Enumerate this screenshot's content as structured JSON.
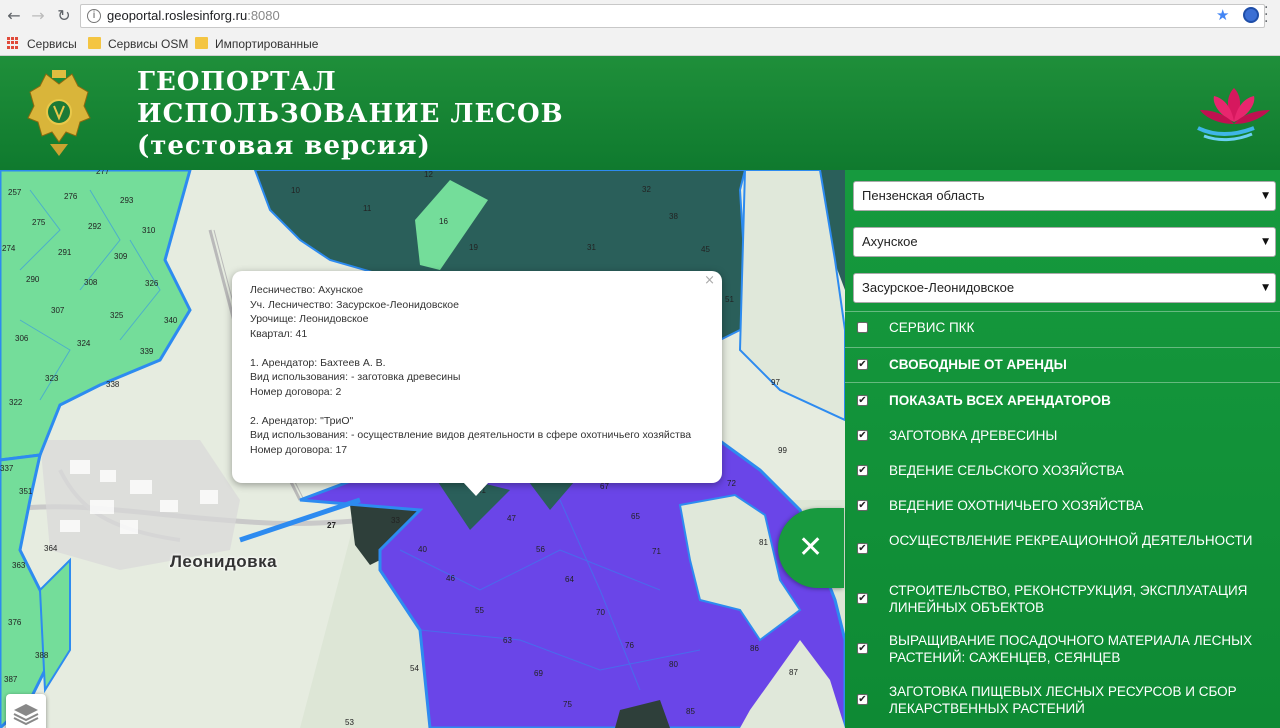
{
  "browser": {
    "url_host": "geoportal.roslesinforg.ru",
    "url_port": ":8080",
    "back_icon": "←",
    "forward_icon": "→",
    "reload_icon": "↻",
    "bookmarks": [
      "Сервисы",
      "Сервисы OSM",
      "Импортированные"
    ]
  },
  "header": {
    "title_line1": "ГЕОПОРТАЛ",
    "title_line2": "ИСПОЛЬЗОВАНИЕ ЛЕСОВ",
    "title_line3": "(тестовая версия)"
  },
  "map": {
    "town_label": "Леонидовка",
    "colors": {
      "tenant": "#6a45e8",
      "free": "#2a5f5a",
      "other": "#74dd9a",
      "boundary": "#2d8bf0"
    },
    "quarter_labels": [
      "257",
      "276",
      "277",
      "293",
      "275",
      "292",
      "310",
      "274",
      "291",
      "309",
      "290",
      "308",
      "326",
      "307",
      "325",
      "340",
      "306",
      "324",
      "339",
      "323",
      "338",
      "322",
      "337",
      "351",
      "364",
      "363",
      "376",
      "388",
      "387",
      "10",
      "11",
      "12",
      "16",
      "19",
      "31",
      "32",
      "38",
      "45",
      "51",
      "97",
      "99",
      "72",
      "81",
      "86",
      "87",
      "67",
      "65",
      "71",
      "47",
      "56",
      "64",
      "70",
      "76",
      "80",
      "85",
      "75",
      "69",
      "63",
      "55",
      "46",
      "40",
      "33",
      "41",
      "27",
      "54",
      "53"
    ]
  },
  "popup": {
    "close_icon": "×",
    "lines": [
      "Лесничество: Ахунское",
      "Уч. Лесничество: Засурское-Леонидовское",
      "Урочище: Леонидовское",
      "Квартал: 41",
      "",
      "1. Арендатор: Бахтеев А. В.",
      "Вид использования: - заготовка древесины",
      "Номер договора: 2",
      "",
      "2. Арендатор: \"ТриО\"",
      "Вид использования: - осуществление видов деятельности в сфере охотничьего хозяйства",
      "Номер договора: 17"
    ]
  },
  "panel": {
    "selects": [
      "Пензенская область",
      "Ахунское",
      "Засурское-Леонидовское"
    ],
    "select_arrow": "▼",
    "items": [
      {
        "label": "СЕРВИС ПКК",
        "checked": false
      },
      {
        "label": "СВОБОДНЫЕ ОТ АРЕНДЫ",
        "checked": true
      },
      {
        "label": "ПОКАЗАТЬ ВСЕХ АРЕНДАТОРОВ",
        "checked": true
      },
      {
        "label": "ЗАГОТОВКА ДРЕВЕСИНЫ",
        "checked": true
      },
      {
        "label": "ВЕДЕНИЕ СЕЛЬСКОГО ХОЗЯЙСТВА",
        "checked": true
      },
      {
        "label": "ВЕДЕНИЕ ОХОТНИЧЬЕГО ХОЗЯЙСТВА",
        "checked": true
      },
      {
        "label": "ОСУЩЕСТВЛЕНИЕ РЕКРЕАЦИОННОЙ ДЕЯТЕЛЬНОСТИ",
        "checked": true
      },
      {
        "label": "СТРОИТЕЛЬСТВО, РЕКОНСТРУКЦИЯ, ЭКСПЛУАТАЦИЯ ЛИНЕЙНЫХ ОБЪЕКТОВ",
        "checked": true
      },
      {
        "label": "ВЫРАЩИВАНИЕ ПОСАДОЧНОГО МАТЕРИАЛА ЛЕСНЫХ РАСТЕНИЙ: САЖЕНЦЕВ, СЕЯНЦЕВ",
        "checked": true
      },
      {
        "label": "ЗАГОТОВКА ПИЩЕВЫХ ЛЕСНЫХ РЕСУРСОВ И СБОР ЛЕКАРСТВЕННЫХ РАСТЕНИЙ",
        "checked": true
      }
    ],
    "check_mark": "✔",
    "close_icon": "✕"
  }
}
